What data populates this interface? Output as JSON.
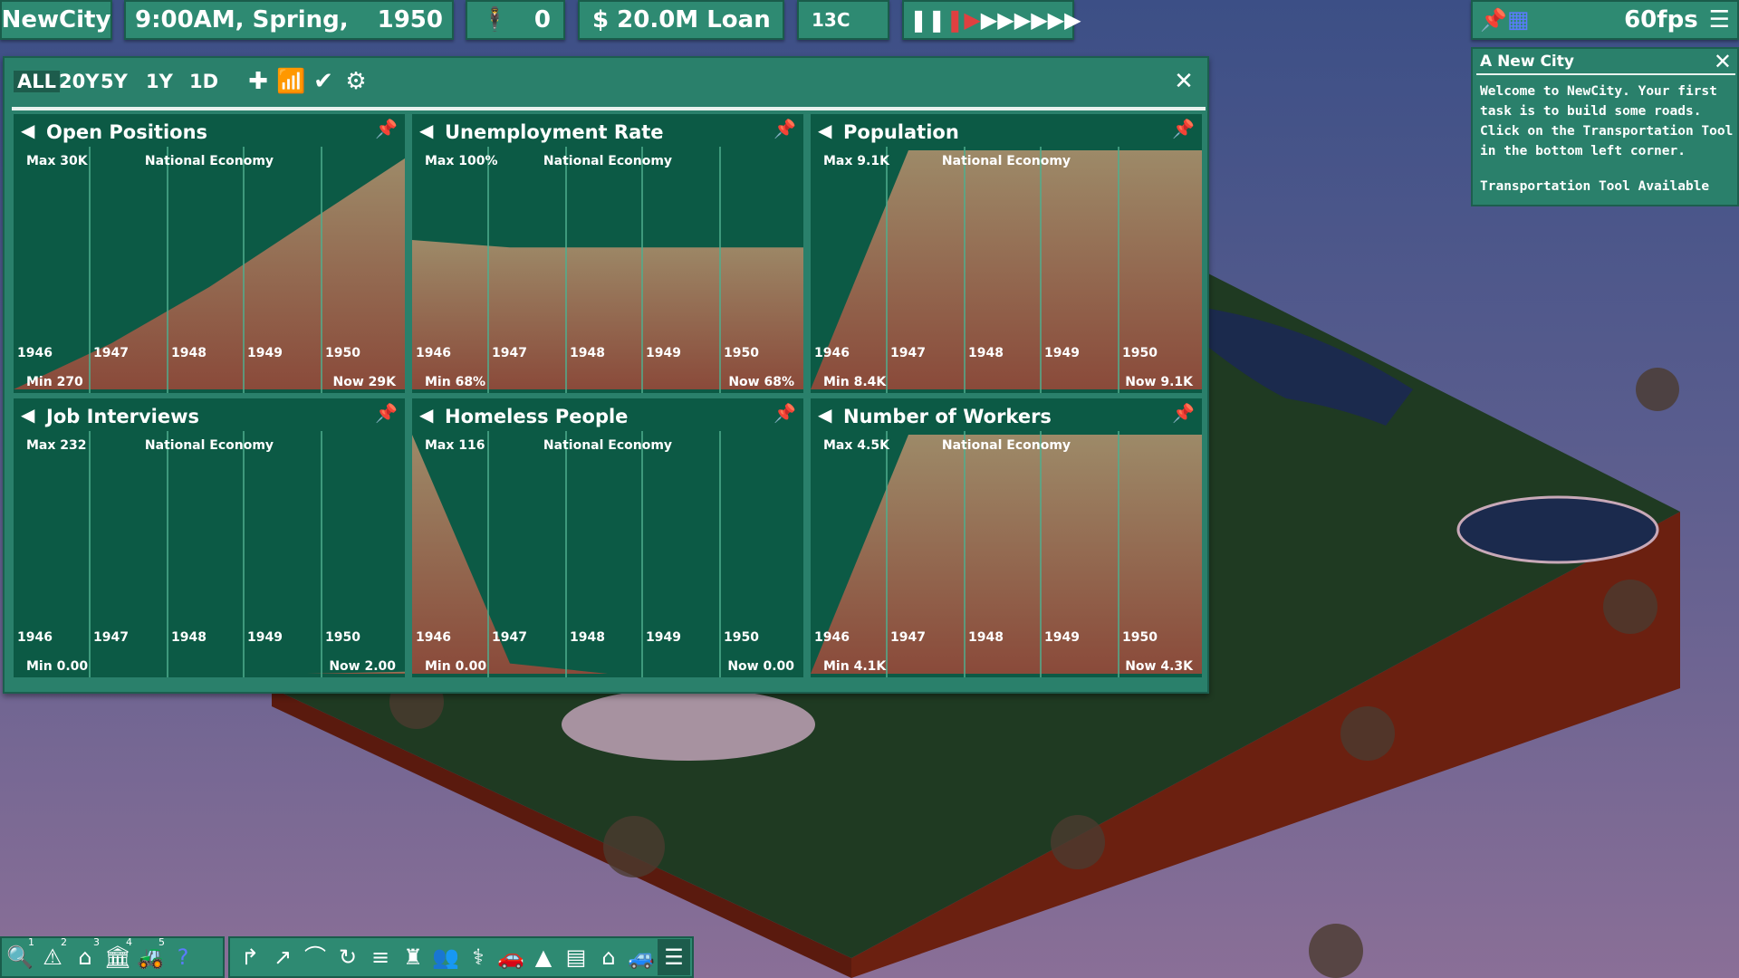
{
  "topbar": {
    "city_name": "NewCity",
    "time": "9:00AM, Spring,",
    "year": "1950",
    "population_count": "0",
    "money": "$ 20.0M Loan",
    "temperature": "13C",
    "fps": "60fps"
  },
  "stats_window": {
    "ranges": [
      "ALL",
      "20Y",
      "5Y",
      "1Y",
      "1D"
    ],
    "active_range": "ALL",
    "close_icon": "close-icon"
  },
  "panels": [
    {
      "title": "Open Positions",
      "subtitle": "National Economy",
      "max": "Max  30K",
      "min": "Min  270",
      "now": "Now  29K",
      "years": [
        "1946",
        "1947",
        "1948",
        "1949",
        "1950"
      ]
    },
    {
      "title": "Unemployment Rate",
      "subtitle": "National Economy",
      "max": "Max  100%",
      "min": "Min  68%",
      "now": "Now  68%",
      "years": [
        "1946",
        "1947",
        "1948",
        "1949",
        "1950"
      ]
    },
    {
      "title": "Population",
      "subtitle": "National Economy",
      "max": "Max  9.1K",
      "min": "Min  8.4K",
      "now": "Now  9.1K",
      "years": [
        "1946",
        "1947",
        "1948",
        "1949",
        "1950"
      ]
    },
    {
      "title": "Job Interviews",
      "subtitle": "National Economy",
      "max": "Max  232",
      "min": "Min  0.00",
      "now": "Now  2.00",
      "years": [
        "1946",
        "1947",
        "1948",
        "1949",
        "1950"
      ]
    },
    {
      "title": "Homeless People",
      "subtitle": "National Economy",
      "max": "Max  116",
      "min": "Min  0.00",
      "now": "Now  0.00",
      "years": [
        "1946",
        "1947",
        "1948",
        "1949",
        "1950"
      ]
    },
    {
      "title": "Number of Workers",
      "subtitle": "National Economy",
      "max": "Max  4.5K",
      "min": "Min  4.1K",
      "now": "Now  4.3K",
      "years": [
        "1946",
        "1947",
        "1948",
        "1949",
        "1950"
      ]
    }
  ],
  "chart_data": [
    {
      "type": "area",
      "title": "Open Positions",
      "x": [
        "1946",
        "1947",
        "1948",
        "1949",
        "1950"
      ],
      "values": [
        270,
        6000,
        13000,
        21000,
        29000
      ],
      "ylim": [
        270,
        30000
      ]
    },
    {
      "type": "area",
      "title": "Unemployment Rate",
      "x": [
        "1946",
        "1947",
        "1948",
        "1949",
        "1950"
      ],
      "values": [
        88,
        87,
        87,
        87,
        87
      ],
      "ylim": [
        68,
        100
      ]
    },
    {
      "type": "area",
      "title": "Population",
      "x": [
        "1946",
        "1947",
        "1948",
        "1949",
        "1950"
      ],
      "values": [
        8400,
        9100,
        9100,
        9100,
        9100
      ],
      "ylim": [
        8400,
        9100
      ]
    },
    {
      "type": "area",
      "title": "Job Interviews",
      "x": [
        "1946",
        "1947",
        "1948",
        "1949",
        "1950"
      ],
      "values": [
        0,
        0,
        0,
        0,
        2
      ],
      "ylim": [
        0,
        232
      ]
    },
    {
      "type": "area",
      "title": "Homeless People",
      "x": [
        "1946",
        "1947",
        "1948",
        "1949",
        "1950"
      ],
      "values": [
        116,
        5,
        0,
        0,
        0
      ],
      "ylim": [
        0,
        116
      ]
    },
    {
      "type": "area",
      "title": "Number of Workers",
      "x": [
        "1946",
        "1947",
        "1948",
        "1949",
        "1950"
      ],
      "values": [
        4100,
        4500,
        4500,
        4500,
        4500
      ],
      "ylim": [
        4100,
        4500
      ]
    }
  ],
  "message": {
    "title": "A New City",
    "body": "Welcome to NewCity. Your first task is to build some roads. Click on the Transportation Tool in the bottom left corner.",
    "footer": "Transportation Tool Available"
  },
  "bottom_left_tools": [
    {
      "icon": "query-icon",
      "num": "1"
    },
    {
      "icon": "road-tool-icon",
      "num": "2"
    },
    {
      "icon": "zone-tool-icon",
      "num": "3"
    },
    {
      "icon": "buildings-tool-icon",
      "num": "4"
    },
    {
      "icon": "bulldozer-tool-icon",
      "num": "5"
    },
    {
      "icon": "help-icon",
      "num": ""
    }
  ],
  "bottom_right_tools": [
    "road-curve-icon",
    "road-ramp-icon",
    "bridge-icon",
    "roundabout-icon",
    "rail-icon",
    "tower-icon",
    "people-icon",
    "medical-icon",
    "car-icon",
    "cone-icon",
    "bus-stop-icon",
    "house-icon",
    "vehicle-icon",
    "messages-icon"
  ]
}
